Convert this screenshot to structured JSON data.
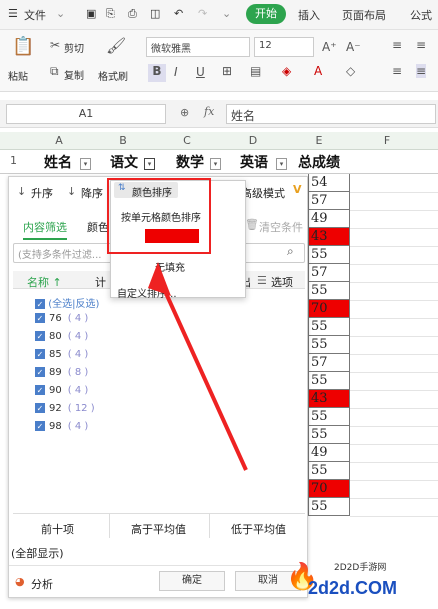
{
  "menubar": {
    "file": "文件",
    "start": "开始",
    "insert": "插入",
    "page_layout": "页面布局",
    "formula": "公式"
  },
  "ribbon": {
    "cut": "剪切",
    "paste": "粘贴",
    "copy": "复制",
    "format_painter": "格式刷",
    "font_name": "微软雅黑",
    "font_size": "12",
    "bold": "B",
    "italic": "I",
    "underline": "U"
  },
  "formula_bar": {
    "cell_ref": "A1",
    "fx": "fx",
    "value": "姓名"
  },
  "columns": [
    "A",
    "B",
    "C",
    "D",
    "E",
    "F"
  ],
  "row_number": "1",
  "headers": [
    "姓名",
    "语文",
    "数学",
    "英语",
    "总成绩"
  ],
  "e_values": [
    "54",
    "57",
    "49",
    "43",
    "55",
    "57",
    "55",
    "70",
    "55",
    "55",
    "57",
    "55",
    "43",
    "55",
    "55",
    "49",
    "55",
    "70",
    "55"
  ],
  "red_rows": [
    3,
    7,
    12,
    17
  ],
  "filter_panel": {
    "sort_asc": "升序",
    "sort_desc": "降序",
    "color_sort": "颜色排序",
    "advanced": "高级模式",
    "tab_content": "内容筛选",
    "tab_color": "颜色",
    "tab_text": "选",
    "clear": "清空条件",
    "search_placeholder": "(支持多条件过滤...",
    "col_name": "名称 ↑",
    "col_count": "计",
    "export": "导出",
    "options": "选项",
    "select_all": "(全选|反选)",
    "items": [
      {
        "v": "76",
        "c": "( 4 )"
      },
      {
        "v": "80",
        "c": "( 4 )"
      },
      {
        "v": "85",
        "c": "( 4 )"
      },
      {
        "v": "89",
        "c": "( 8 )"
      },
      {
        "v": "90",
        "c": "( 4 )"
      },
      {
        "v": "92",
        "c": "( 12 )"
      },
      {
        "v": "98",
        "c": "( 4 )"
      }
    ],
    "top_ten": "前十项",
    "above_avg": "高于平均值",
    "below_avg": "低于平均值",
    "show_all": "(全部显示)",
    "analysis": "分析",
    "ok": "确定",
    "cancel": "取消"
  },
  "popup": {
    "title": "按单元格颜色排序",
    "no_fill": "无填充",
    "custom": "自定义排序...",
    "swatch_color": "#ee0000"
  },
  "watermark": {
    "site": "2D2D手游网",
    "domain": "2d2d.COM"
  },
  "colors": {
    "accent": "#2da44e",
    "red": "#ee0000",
    "annotation": "#e22222"
  }
}
